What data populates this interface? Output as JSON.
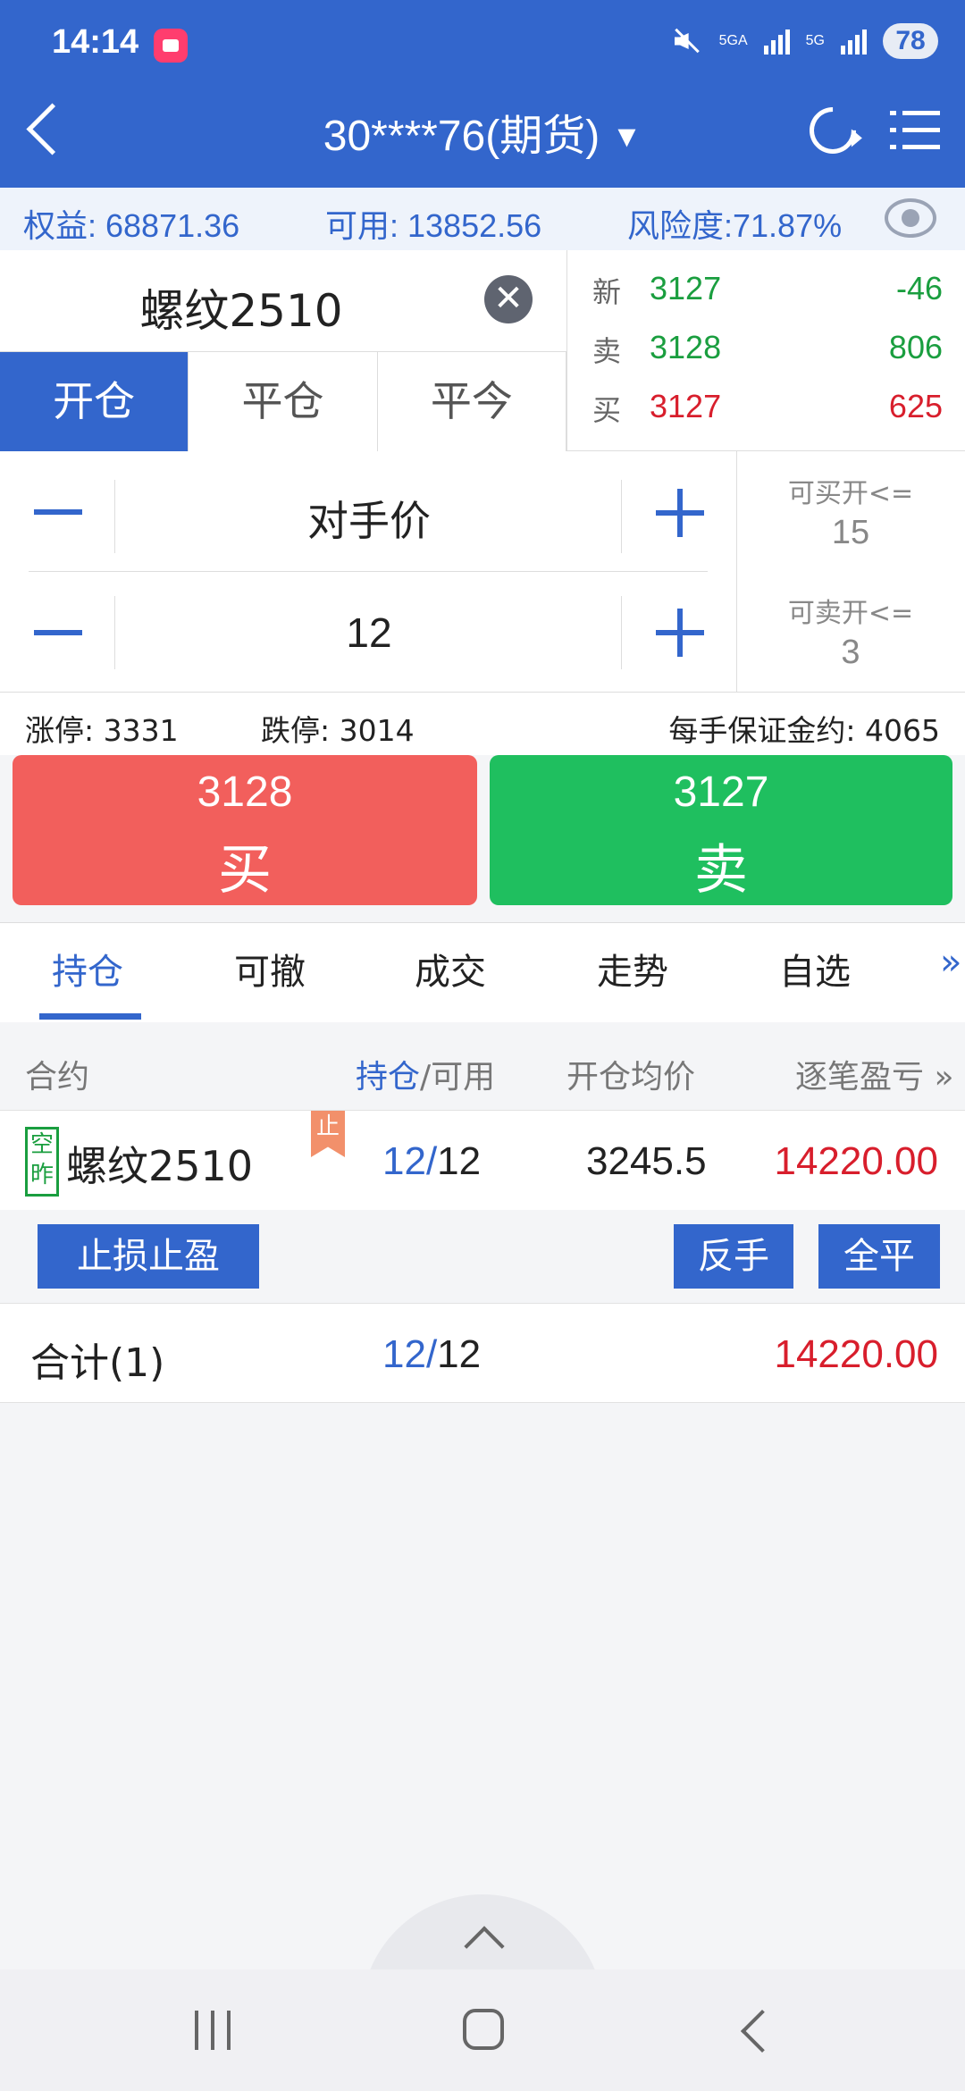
{
  "status_bar": {
    "time": "14:14",
    "net1": "5GA",
    "net2": "5G",
    "battery": "78"
  },
  "header": {
    "account_title": "30****76(期货)"
  },
  "account": {
    "equity_label": "权益: 68871.36",
    "available_label": "可用: 13852.56",
    "risk_label": "风险度:71.87%"
  },
  "contract": {
    "name": "螺纹2510"
  },
  "trade_tabs": [
    "开仓",
    "平仓",
    "平今"
  ],
  "quote": {
    "last": {
      "label": "新",
      "price": "3127",
      "value": "-46"
    },
    "ask": {
      "label": "卖",
      "price": "3128",
      "value": "806"
    },
    "bid": {
      "label": "买",
      "price": "3127",
      "value": "625"
    }
  },
  "order": {
    "price_mode": "对手价",
    "quantity": "12",
    "buy_open_label": "可买开<=",
    "buy_open_value": "15",
    "sell_open_label": "可卖开<=",
    "sell_open_value": "3"
  },
  "limits": {
    "limit_up": "涨停: 3331",
    "limit_down": "跌停: 3014",
    "margin": "每手保证金约: 4065"
  },
  "buttons": {
    "buy_price": "3128",
    "buy_label": "买",
    "sell_price": "3127",
    "sell_label": "卖"
  },
  "bottom_tabs": [
    "持仓",
    "可撤",
    "成交",
    "走势",
    "自选"
  ],
  "bottom_tabs_more": "»",
  "positions": {
    "headers": {
      "contract": "合约",
      "hold": "持仓",
      "available": "/可用",
      "avg_price": "开仓均价",
      "pnl": "逐笔盈亏 »"
    },
    "rows": [
      {
        "direction_tag": "空昨",
        "stop_tag": "止",
        "name": "螺纹2510",
        "hold": "12/",
        "available": "12",
        "avg_price": "3245.5",
        "pnl": "14220.00"
      }
    ],
    "actions": {
      "stop_loss": "止损止盈",
      "reverse": "反手",
      "close_all": "全平"
    },
    "total": {
      "label": "合计(1)",
      "hold": "12/",
      "available": "12",
      "pnl": "14220.00"
    }
  },
  "colors": {
    "brand": "#3366cc",
    "buy": "#f25f5c",
    "sell": "#1fbf5f",
    "up": "#d81e2c",
    "down": "#1a9e3f"
  }
}
